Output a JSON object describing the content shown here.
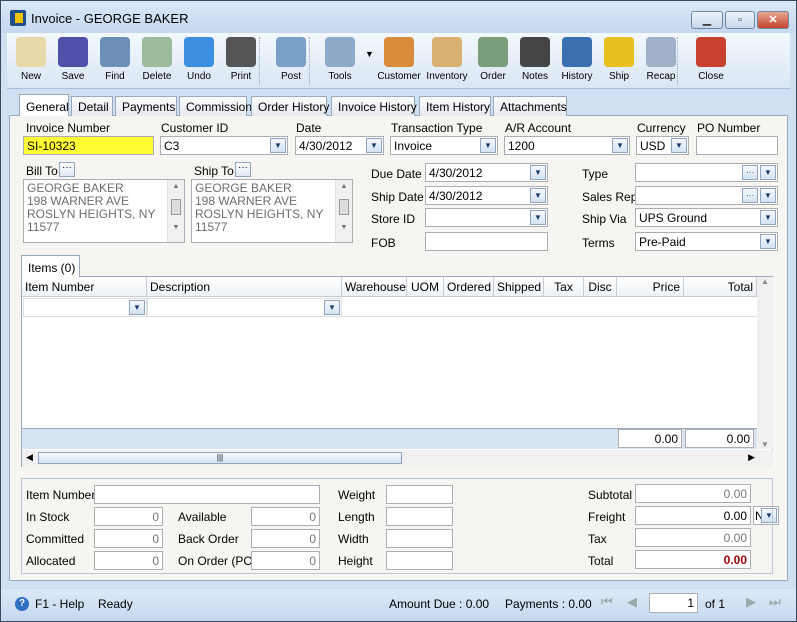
{
  "window": {
    "title": "Invoice - GEORGE BAKER",
    "controls": [
      "minimize",
      "maximize",
      "close"
    ]
  },
  "toolbar": [
    {
      "label": "New",
      "icon": "new-document-icon"
    },
    {
      "label": "Save",
      "icon": "floppy-disk-icon"
    },
    {
      "label": "Find",
      "icon": "binoculars-icon"
    },
    {
      "label": "Delete",
      "icon": "recycle-bin-icon"
    },
    {
      "label": "Undo",
      "icon": "undo-arrow-icon"
    },
    {
      "label": "Print",
      "icon": "printer-icon"
    },
    {
      "label": "Post",
      "icon": "post-checkmark-icon"
    },
    {
      "label": "Tools",
      "icon": "tools-icon"
    },
    {
      "label": "Customer",
      "icon": "customer-person-icon"
    },
    {
      "label": "Inventory",
      "icon": "boxes-icon"
    },
    {
      "label": "Order",
      "icon": "pda-icon"
    },
    {
      "label": "Notes",
      "icon": "notepad-pen-icon"
    },
    {
      "label": "History",
      "icon": "person-hourglass-icon"
    },
    {
      "label": "Ship",
      "icon": "forklift-icon"
    },
    {
      "label": "Recap",
      "icon": "recap-documents-icon"
    },
    {
      "label": "Close",
      "icon": "close-window-icon"
    }
  ],
  "tabs": [
    "General",
    "Detail",
    "Payments",
    "Commission",
    "Order History",
    "Invoice History",
    "Item History",
    "Attachments"
  ],
  "header": {
    "invoice_number": {
      "label": "Invoice Number",
      "value": "SI-10323"
    },
    "customer_id": {
      "label": "Customer ID",
      "value": "C3"
    },
    "date": {
      "label": "Date",
      "value": "4/30/2012"
    },
    "transaction_type": {
      "label": "Transaction Type",
      "value": "Invoice"
    },
    "ar_account": {
      "label": "A/R Account",
      "value": "1200"
    },
    "currency": {
      "label": "Currency",
      "value": "USD"
    },
    "po_number": {
      "label": "PO Number",
      "value": ""
    }
  },
  "bill_to": {
    "label": "Bill To",
    "lines": [
      "GEORGE BAKER",
      "198 WARNER AVE",
      "ROSLYN HEIGHTS, NY",
      "11577"
    ]
  },
  "ship_to": {
    "label": "Ship To",
    "lines": [
      "GEORGE BAKER",
      "198 WARNER AVE",
      "ROSLYN HEIGHTS, NY",
      "11577"
    ]
  },
  "mid": {
    "due_date": {
      "label": "Due Date",
      "value": "4/30/2012"
    },
    "ship_date": {
      "label": "Ship Date",
      "value": "4/30/2012"
    },
    "store_id": {
      "label": "Store ID",
      "value": ""
    },
    "fob": {
      "label": "FOB",
      "value": ""
    }
  },
  "right": {
    "type": {
      "label": "Type",
      "value": ""
    },
    "sales_rep": {
      "label": "Sales Rep",
      "value": ""
    },
    "ship_via": {
      "label": "Ship Via",
      "value": "UPS Ground"
    },
    "terms": {
      "label": "Terms",
      "value": "Pre-Paid"
    }
  },
  "items": {
    "tab": "Items (0)",
    "columns": [
      "Item Number",
      "Description",
      "Warehouse",
      "UOM",
      "Ordered",
      "Shipped",
      "Tax",
      "Disc",
      "Price",
      "Total"
    ],
    "footer_price": "0.00",
    "footer_total": "0.00"
  },
  "details": {
    "item_number": {
      "label": "Item Number",
      "value": ""
    },
    "in_stock": {
      "label": "In Stock",
      "value": "0"
    },
    "committed": {
      "label": "Committed",
      "value": "0"
    },
    "allocated": {
      "label": "Allocated",
      "value": "0"
    },
    "available": {
      "label": "Available",
      "value": "0"
    },
    "back_order": {
      "label": "Back Order",
      "value": "0"
    },
    "on_order": {
      "label": "On Order (PO)",
      "value": "0"
    },
    "weight": {
      "label": "Weight",
      "value": ""
    },
    "length": {
      "label": "Length",
      "value": ""
    },
    "width": {
      "label": "Width",
      "value": ""
    },
    "height": {
      "label": "Height",
      "value": ""
    }
  },
  "totals": {
    "subtotal": {
      "label": "Subtotal",
      "value": "0.00"
    },
    "freight": {
      "label": "Freight",
      "value": "0.00",
      "option": "N"
    },
    "tax": {
      "label": "Tax",
      "value": "0.00"
    },
    "total": {
      "label": "Total",
      "value": "0.00"
    }
  },
  "status": {
    "help": "F1 - Help",
    "state": "Ready",
    "amount_due": "Amount Due : 0.00",
    "payments": "Payments : 0.00",
    "page": "1",
    "of": "of 1"
  },
  "colors": {
    "highlight": "#ffff33",
    "total_red": "#a00000"
  }
}
